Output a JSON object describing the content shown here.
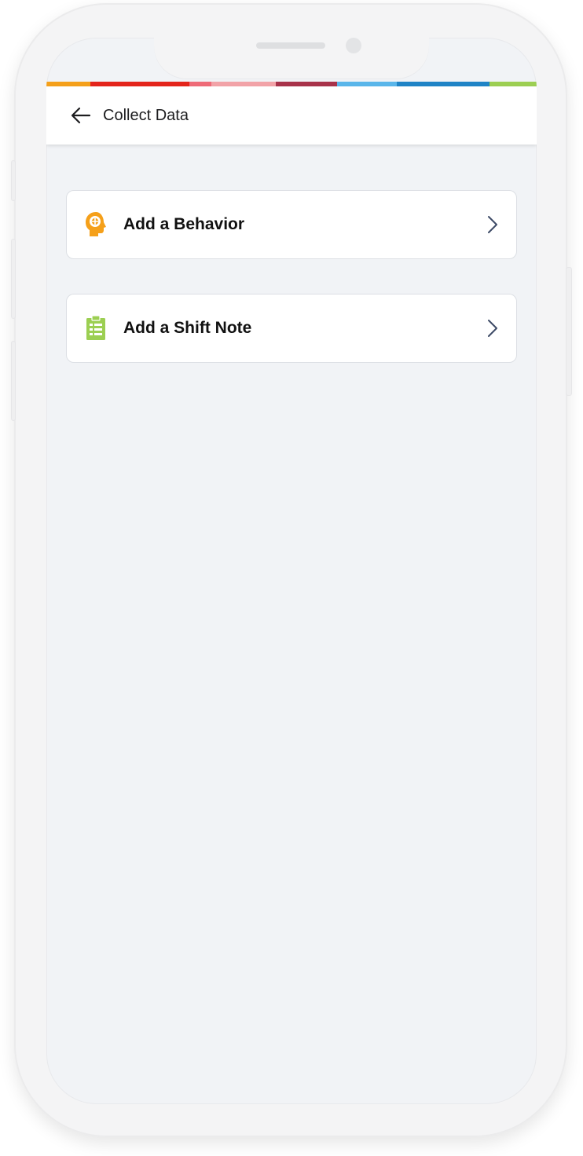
{
  "header": {
    "title": "Collect Data"
  },
  "stripe_colors": [
    "#f5a01a",
    "#e4241b",
    "#ef6b78",
    "#f2a3a8",
    "#a8324a",
    "#5ab6ea",
    "#1f84c6",
    "#9ccf52"
  ],
  "menu": {
    "items": [
      {
        "label": "Add a Behavior",
        "icon": "head-target-icon",
        "icon_color": "#f5a01a"
      },
      {
        "label": "Add a Shift Note",
        "icon": "clipboard-list-icon",
        "icon_color": "#9ccf52"
      }
    ]
  },
  "colors": {
    "chevron": "#3c4a66",
    "screen_bg": "#f1f3f6"
  }
}
